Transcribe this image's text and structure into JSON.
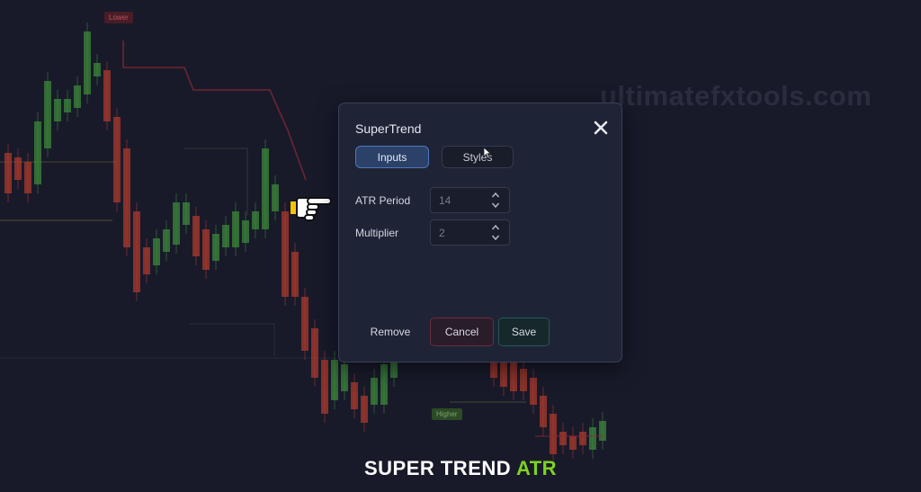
{
  "chart": {
    "up_color": "#3f8a3c",
    "down_color": "#b03a2e",
    "labels": {
      "lower": "Lower",
      "higher": "Higher"
    }
  },
  "watermark": "ultimatefxtools.com",
  "dialog": {
    "title": "SuperTrend",
    "tabs": [
      {
        "label": "Inputs",
        "active": true
      },
      {
        "label": "Styles",
        "active": false
      }
    ],
    "fields": [
      {
        "label": "ATR Period",
        "value": "14"
      },
      {
        "label": "Multiplier",
        "value": "2"
      }
    ],
    "buttons": {
      "remove": "Remove",
      "cancel": "Cancel",
      "save": "Save"
    },
    "accent": "#4c78b8"
  },
  "caption": {
    "main": "SUPER TREND ",
    "accent": "ATR",
    "accent_color": "#7ed321"
  },
  "icons": {
    "close": "close-icon",
    "pointer": "hand-pointer-icon",
    "cursor": "mouse-cursor-icon"
  }
}
